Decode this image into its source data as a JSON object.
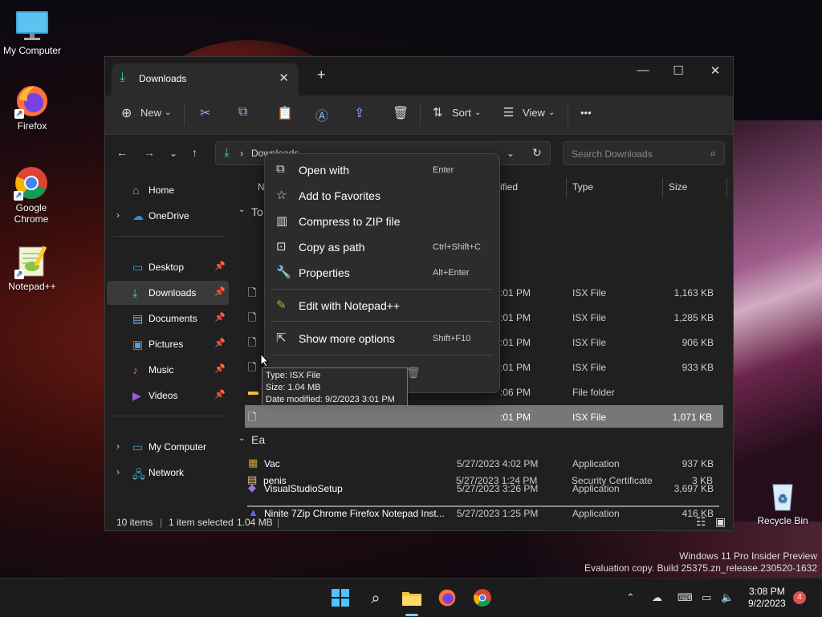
{
  "desktop": {
    "icons": [
      {
        "label": "My Computer"
      },
      {
        "label": "Firefox"
      },
      {
        "label": "Google Chrome"
      },
      {
        "label": "Notepad++"
      },
      {
        "label": "Recycle Bin"
      }
    ]
  },
  "window": {
    "tab_title": "Downloads",
    "new_tab": "+",
    "controls": {
      "minimize": "—",
      "maximize": "☐",
      "close": "✕"
    }
  },
  "toolbar": {
    "new_label": "New",
    "sort_label": "Sort",
    "view_label": "View",
    "more_label": "•••"
  },
  "address": {
    "path": "Downloads",
    "search_placeholder": "Search Downloads"
  },
  "sidebar": {
    "items": [
      {
        "label": "Home"
      },
      {
        "label": "OneDrive"
      },
      {
        "label": "Desktop"
      },
      {
        "label": "Downloads"
      },
      {
        "label": "Documents"
      },
      {
        "label": "Pictures"
      },
      {
        "label": "Music"
      },
      {
        "label": "Videos"
      },
      {
        "label": "My Computer"
      },
      {
        "label": "Network"
      }
    ]
  },
  "columns": {
    "name": "N",
    "modified": "ified",
    "type": "Type",
    "size": "Size"
  },
  "groups": {
    "today": "To",
    "earlier": "Ea"
  },
  "files_today": [
    {
      "date": ":01 PM",
      "type": "ISX File",
      "size": "1,163 KB"
    },
    {
      "date": ":01 PM",
      "type": "ISX File",
      "size": "1,285 KB"
    },
    {
      "date": ":01 PM",
      "type": "ISX File",
      "size": "906 KB"
    },
    {
      "date": ":01 PM",
      "type": "ISX File",
      "size": "933 KB"
    },
    {
      "date": ":06 PM",
      "type": "File folder",
      "size": ""
    },
    {
      "date": ":01 PM",
      "type": "ISX File",
      "size": "1,071 KB"
    }
  ],
  "files_earlier": [
    {
      "name": "Vac",
      "date": "5/27/2023 4:02 PM",
      "type": "Application",
      "size": "937 KB"
    },
    {
      "name": "VisualStudioSetup",
      "date": "5/27/2023 3:26 PM",
      "type": "Application",
      "size": "3,697 KB"
    },
    {
      "name": "Ninite 7Zip Chrome Firefox Notepad Inst...",
      "date": "5/27/2023 1:25 PM",
      "type": "Application",
      "size": "416 KB"
    },
    {
      "name": "penis",
      "date": "5/27/2023 1:24 PM",
      "type": "Security Certificate",
      "size": "3 KB"
    }
  ],
  "context_menu": {
    "items": [
      {
        "label": "Open with",
        "shortcut": "Enter"
      },
      {
        "label": "Add to Favorites",
        "shortcut": ""
      },
      {
        "label": "Compress to ZIP file",
        "shortcut": ""
      },
      {
        "label": "Copy as path",
        "shortcut": "Ctrl+Shift+C"
      },
      {
        "label": "Properties",
        "shortcut": "Alt+Enter"
      },
      {
        "label": "Edit with Notepad++",
        "shortcut": ""
      },
      {
        "label": "Show more options",
        "shortcut": "Shift+F10"
      }
    ]
  },
  "tooltip": {
    "type": "Type: ISX File",
    "size": "Size: 1.04 MB",
    "modified": "Date modified: 9/2/2023 3:01 PM"
  },
  "status": {
    "items": "10 items",
    "selected": "1 item selected",
    "size": "1.04 MB"
  },
  "watermark": {
    "line1": "Windows 11 Pro Insider Preview",
    "line2": "Evaluation copy. Build 25375.zn_release.230520-1632"
  },
  "taskbar": {
    "time": "3:08 PM",
    "date": "9/2/2023",
    "badge": "4"
  },
  "colors": {
    "accent": "#4ec9a8",
    "window_bg": "#202020",
    "selection": "#777777"
  }
}
